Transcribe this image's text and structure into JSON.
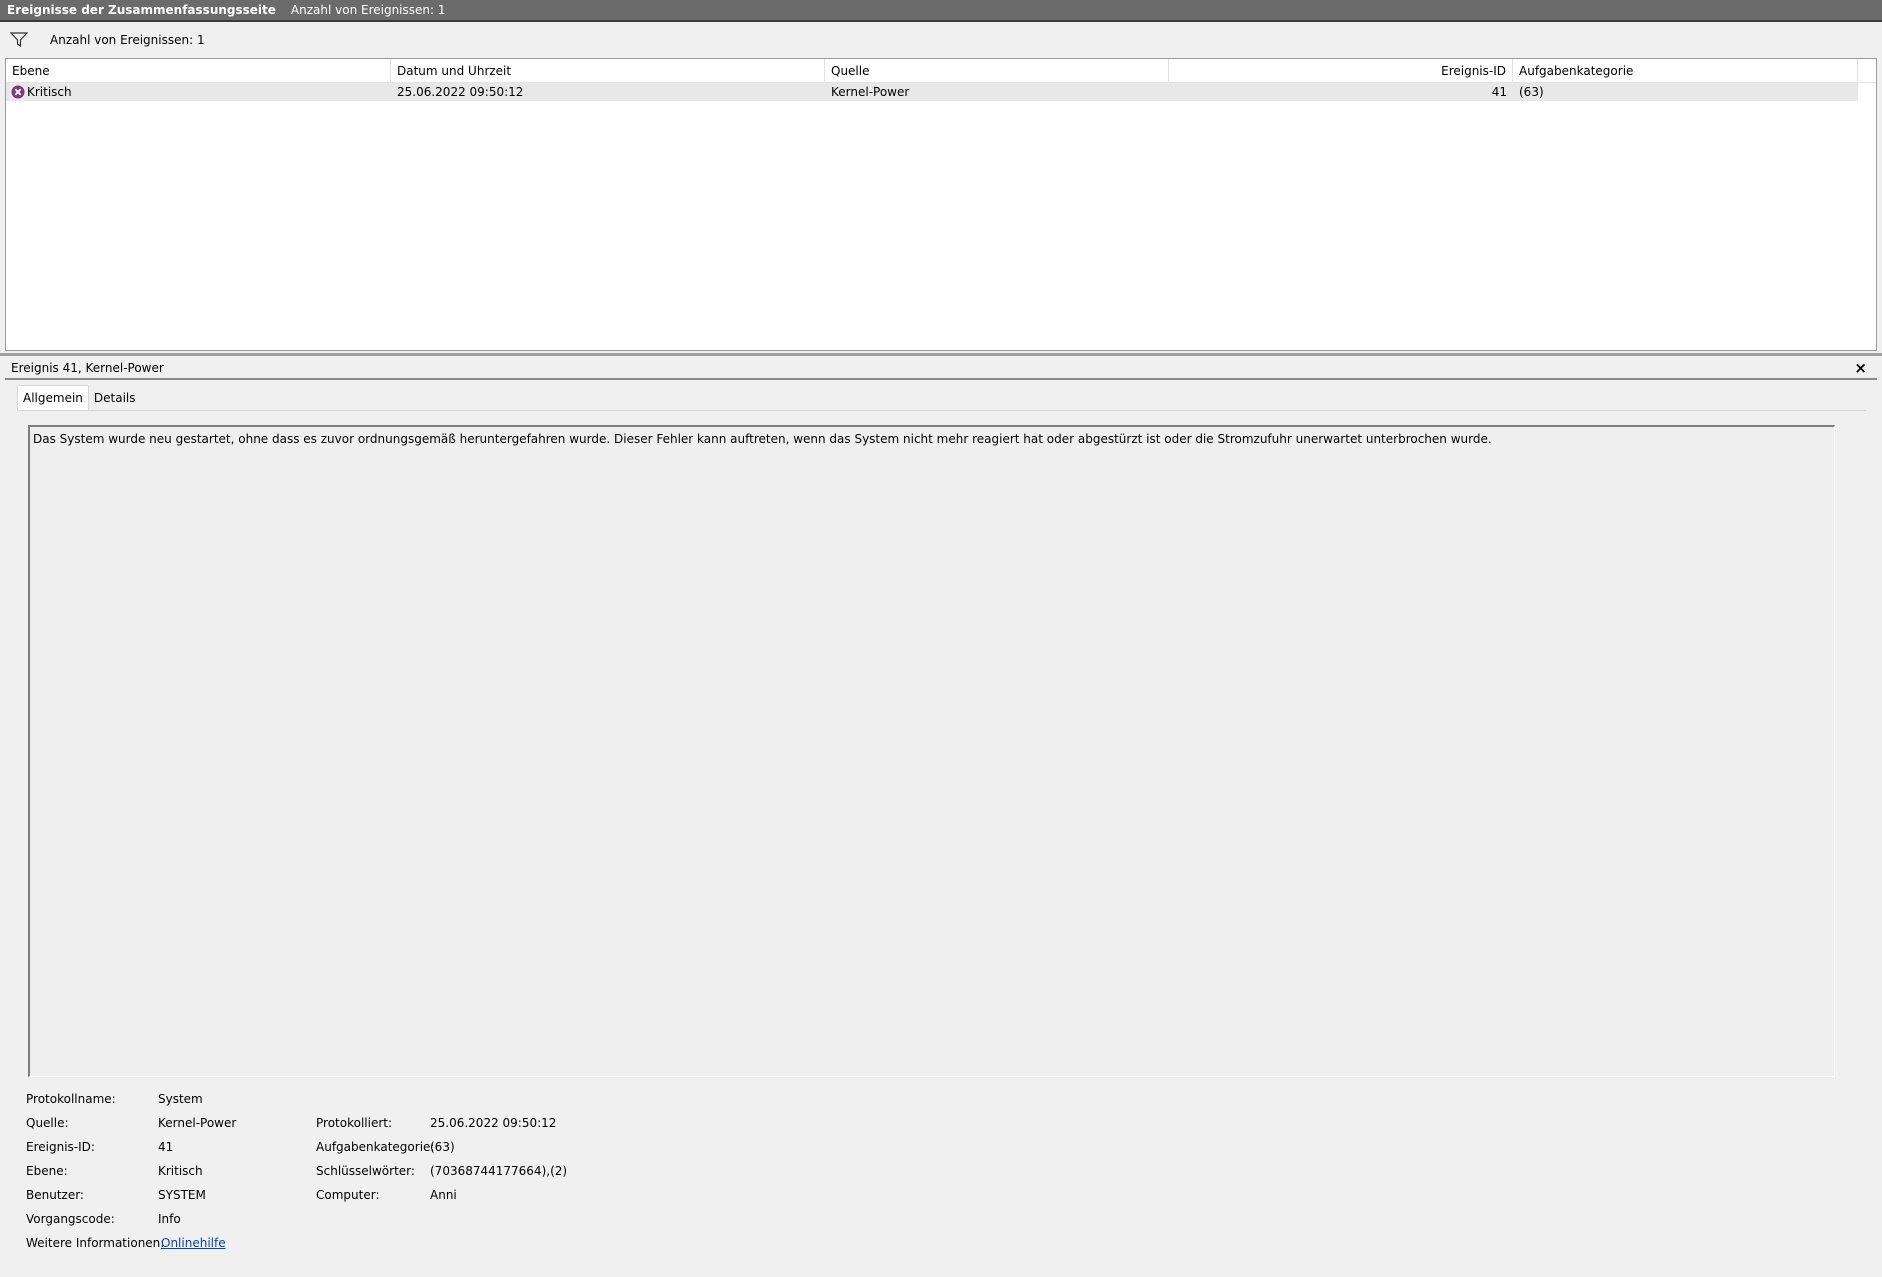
{
  "header": {
    "title": "Ereignisse der Zusammenfassungsseite",
    "count_text": "Anzahl von Ereignissen: 1"
  },
  "filter": {
    "count_text": "Anzahl von Ereignissen: 1",
    "icon": "funnel-icon"
  },
  "table": {
    "columns": [
      "Ebene",
      "Datum und Uhrzeit",
      "Quelle",
      "Ereignis-ID",
      "Aufgabenkategorie"
    ],
    "rows": [
      {
        "level": "Kritisch",
        "level_icon": "critical-icon",
        "datetime": "25.06.2022 09:50:12",
        "source": "Kernel-Power",
        "event_id": "41",
        "task_category": "(63)"
      }
    ]
  },
  "detail": {
    "title": "Ereignis 41, Kernel-Power",
    "close_label": "×",
    "tabs": [
      {
        "label": "Allgemein",
        "active": true
      },
      {
        "label": "Details",
        "active": false
      }
    ],
    "description": "Das System wurde neu gestartet, ohne dass es zuvor ordnungsgemäß heruntergefahren wurde. Dieser Fehler kann auftreten, wenn das System nicht mehr reagiert hat oder abgestürzt ist oder die Stromzufuhr unerwartet unterbrochen wurde.",
    "properties": {
      "log_name": {
        "label": "Protokollname:",
        "value": "System"
      },
      "source": {
        "label": "Quelle:",
        "value": "Kernel-Power"
      },
      "event_id": {
        "label": "Ereignis-ID:",
        "value": "41"
      },
      "level": {
        "label": "Ebene:",
        "value": "Kritisch"
      },
      "user": {
        "label": "Benutzer:",
        "value": "SYSTEM"
      },
      "opcode": {
        "label": "Vorgangscode:",
        "value": "Info"
      },
      "more_info": {
        "label": "Weitere Informationen:",
        "value": "Onlinehilfe"
      },
      "logged": {
        "label": "Protokolliert:",
        "value": "25.06.2022 09:50:12"
      },
      "task_category": {
        "label": "Aufgabenkategorie:",
        "value": "(63)"
      },
      "keywords": {
        "label": "Schlüsselwörter:",
        "value": "(70368744177664),(2)"
      },
      "computer": {
        "label": "Computer:",
        "value": "Anni"
      }
    }
  },
  "colors": {
    "titlebar": "#6b6b6b",
    "critical": "#7a3b7a",
    "link": "#0645ad"
  }
}
